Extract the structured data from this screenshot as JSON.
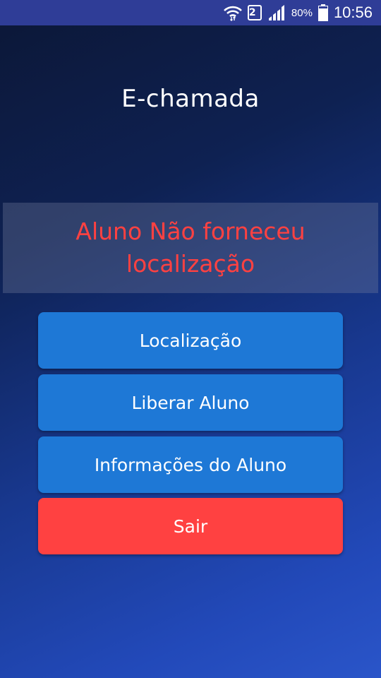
{
  "status_bar": {
    "wifi_icon": "wifi-icon",
    "sim_label": "2",
    "signal_icon": "signal-icon",
    "battery_percent": "80%",
    "battery_icon": "battery-icon",
    "time": "10:56",
    "background_color": "#2f3d97"
  },
  "app": {
    "title": "E-chamada"
  },
  "warning": {
    "message": "Aluno Não forneceu localização",
    "color": "#ff4141"
  },
  "buttons": {
    "location": "Localização",
    "release_student": "Liberar Aluno",
    "student_info": "Informações do Aluno",
    "exit": "Sair"
  },
  "colors": {
    "primary_button": "#1e78d6",
    "exit_button": "#ff4141"
  }
}
